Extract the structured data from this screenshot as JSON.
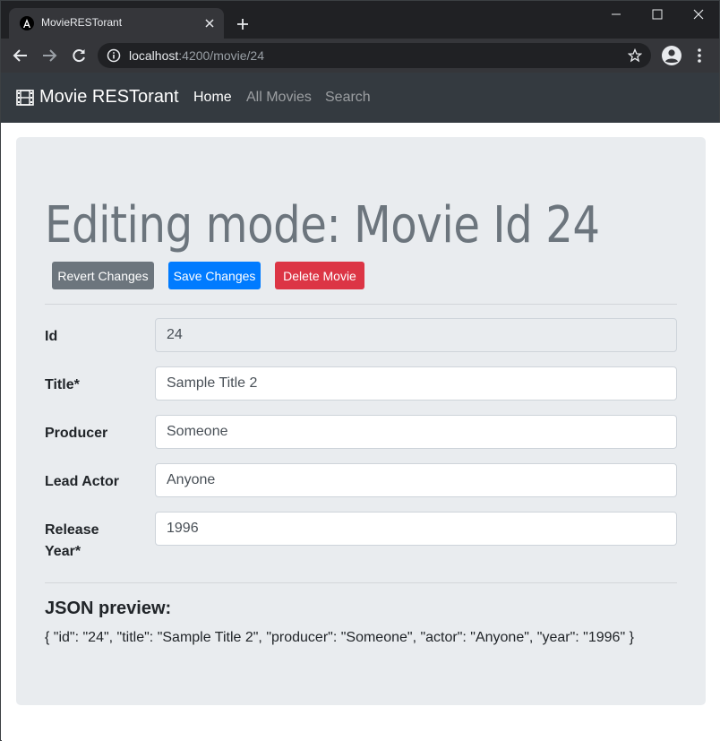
{
  "browser": {
    "tab_title": "MovieRESTorant",
    "url_host": "localhost",
    "url_path": ":4200/movie/24"
  },
  "navbar": {
    "brand": "Movie RESTorant",
    "links": [
      "Home",
      "All Movies",
      "Search"
    ],
    "active_link": "Home"
  },
  "page": {
    "title": "Editing mode: Movie Id 24",
    "buttons": {
      "revert": "Revert Changes",
      "save": "Save Changes",
      "delete": "Delete Movie"
    },
    "form": {
      "id": {
        "label": "Id",
        "value": "24"
      },
      "title": {
        "label": "Title*",
        "value": "Sample Title 2"
      },
      "producer": {
        "label": "Producer",
        "value": "Someone"
      },
      "actor": {
        "label": "Lead Actor",
        "value": "Anyone"
      },
      "year": {
        "label_line1": "Release",
        "label_line2": "Year*",
        "value": "1996"
      }
    },
    "json_title": "JSON preview:",
    "json_preview": "{ \"id\": \"24\", \"title\": \"Sample Title 2\", \"producer\": \"Someone\", \"actor\": \"Anyone\", \"year\": \"1996\" }"
  },
  "colors": {
    "navbar_bg": "#343a40",
    "jumbotron_bg": "#e9ecef",
    "btn_secondary": "#6c757d",
    "btn_primary": "#007bff",
    "btn_danger": "#dc3545"
  },
  "icons": [
    "angular-icon",
    "close-icon",
    "plus-icon",
    "minimize-icon",
    "maximize-icon",
    "back-icon",
    "forward-icon",
    "reload-icon",
    "info-icon",
    "star-icon",
    "account-icon",
    "more-vert-icon",
    "film-icon"
  ]
}
